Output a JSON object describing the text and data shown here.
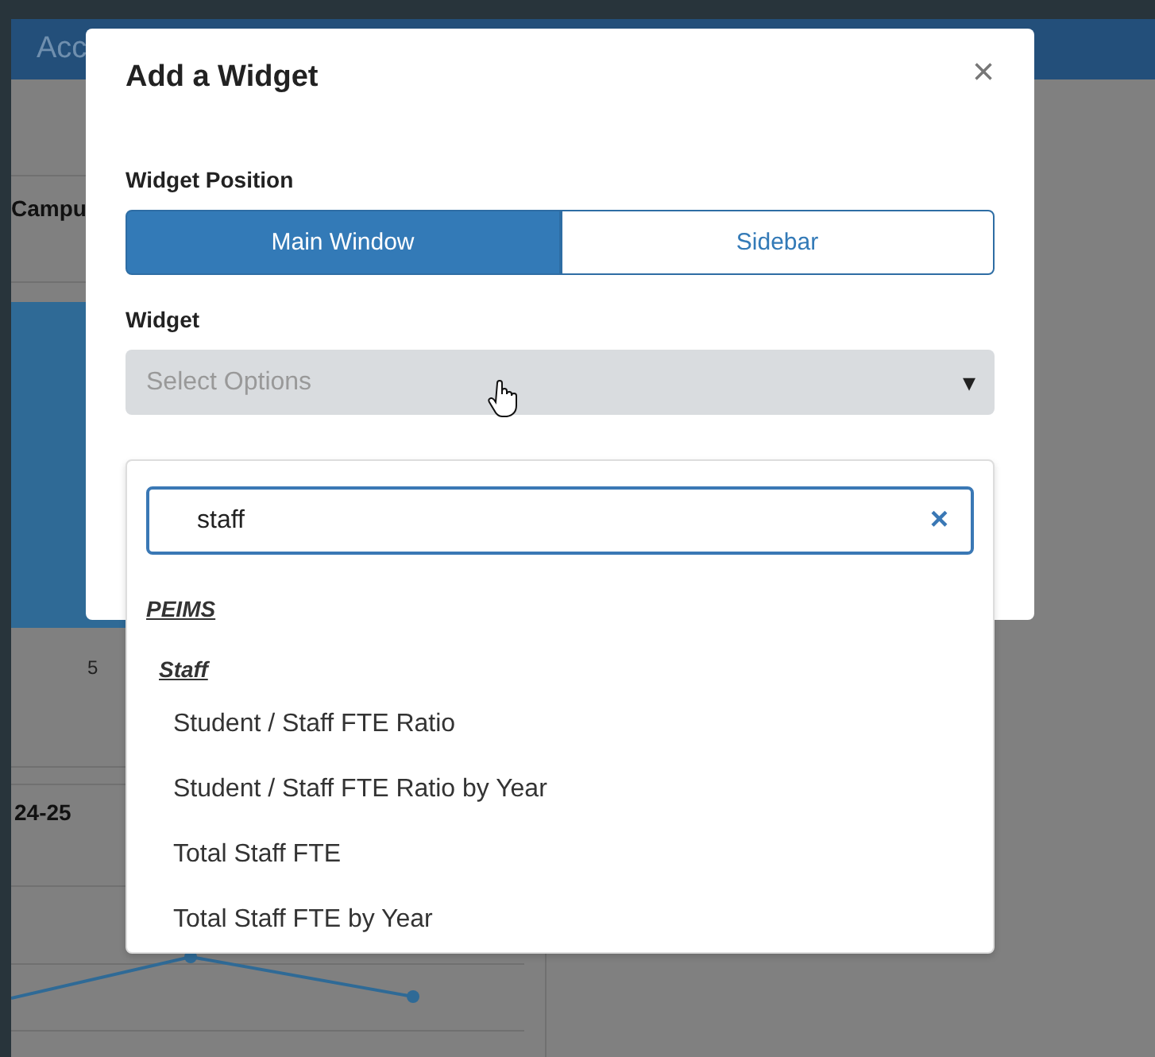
{
  "header": {
    "nav": [
      "Acc"
    ]
  },
  "background": {
    "column_heading": "Campu",
    "cell": "5",
    "row_heading": "24-25"
  },
  "modal": {
    "title": "Add a Widget",
    "close": "×",
    "position": {
      "label": "Widget Position",
      "options": [
        {
          "label": "Main Window",
          "selected": true
        },
        {
          "label": "Sidebar",
          "selected": false
        }
      ]
    },
    "widget": {
      "label": "Widget",
      "placeholder": "Select Options",
      "caret": "▾",
      "dropdown": {
        "search_value": "staff",
        "clear": "×",
        "groups": [
          {
            "label": "PEIMS",
            "children": [
              {
                "label": "Staff",
                "children": [
                  {
                    "label": "Student / Staff FTE Ratio"
                  },
                  {
                    "label": "Student / Staff FTE Ratio by Year"
                  },
                  {
                    "label": "Total Staff FTE"
                  },
                  {
                    "label": "Total Staff FTE by Year"
                  }
                ]
              }
            ]
          }
        ]
      }
    }
  }
}
